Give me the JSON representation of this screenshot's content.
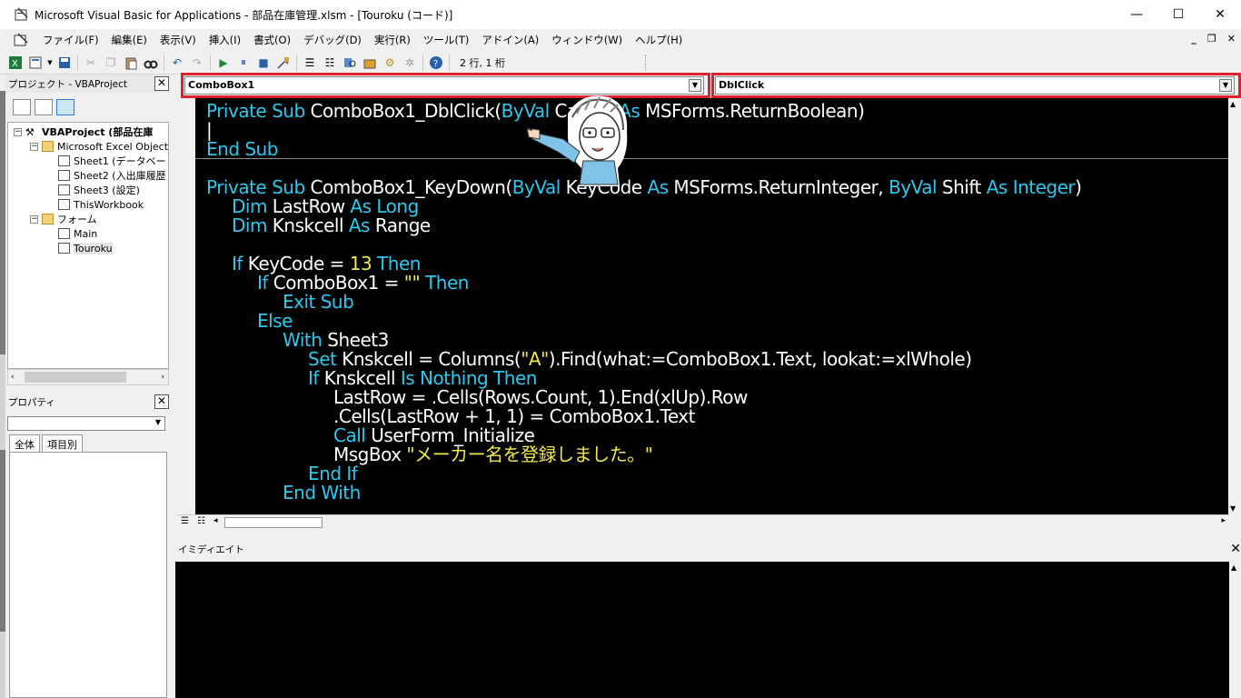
{
  "window": {
    "title": "Microsoft Visual Basic for Applications - 部品在庫管理.xlsm - [Touroku (コード)]",
    "minimize": "—",
    "maximize": "☐",
    "close": "✕"
  },
  "menu": [
    "ファイル(F)",
    "編集(E)",
    "表示(V)",
    "挿入(I)",
    "書式(O)",
    "デバッグ(D)",
    "実行(R)",
    "ツール(T)",
    "アドイン(A)",
    "ウィンドウ(W)",
    "ヘルプ(H)"
  ],
  "mdi": {
    "minimize": "_",
    "restore": "❐",
    "close": "✕"
  },
  "toolbar": {
    "status": "2 行, 1 桁"
  },
  "project": {
    "title": "プロジェクト - VBAProject",
    "tree": [
      {
        "label": "VBAProject (部品在庫",
        "level": 0,
        "type": "vba",
        "toggle": "−",
        "bold": true
      },
      {
        "label": "Microsoft Excel Object",
        "level": 1,
        "type": "folder",
        "toggle": "−"
      },
      {
        "label": "Sheet1 (データベー",
        "level": 2,
        "type": "sheet",
        "toggle": ""
      },
      {
        "label": "Sheet2 (入出庫履歴",
        "level": 2,
        "type": "sheet",
        "toggle": ""
      },
      {
        "label": "Sheet3 (設定)",
        "level": 2,
        "type": "sheet",
        "toggle": ""
      },
      {
        "label": "ThisWorkbook",
        "level": 2,
        "type": "sheet",
        "toggle": ""
      },
      {
        "label": "フォーム",
        "level": 1,
        "type": "folder",
        "toggle": "−"
      },
      {
        "label": "Main",
        "level": 2,
        "type": "form",
        "toggle": ""
      },
      {
        "label": "Touroku",
        "level": 2,
        "type": "form",
        "toggle": "",
        "selected": true
      }
    ]
  },
  "properties": {
    "title": "プロパティ",
    "tabs": [
      "全体",
      "項目別"
    ]
  },
  "code": {
    "object_combo": "ComboBox1",
    "procedure_combo": "DblClick",
    "highlight_color": "#e0202a",
    "lines": [
      {
        "indent": 0,
        "tokens": [
          [
            "kw",
            "Private Sub "
          ],
          [
            "t",
            "ComboBox1_DblClick("
          ],
          [
            "kw",
            "ByVal "
          ],
          [
            "t",
            "Cancel "
          ],
          [
            "kw",
            "As "
          ],
          [
            "t",
            "MSForms.ReturnBoolean)"
          ]
        ]
      },
      {
        "indent": 0,
        "tokens": [
          [
            "t",
            "|"
          ]
        ]
      },
      {
        "indent": 0,
        "tokens": [
          [
            "kw",
            "End Sub"
          ]
        ]
      },
      {
        "indent": 0,
        "tokens": []
      },
      {
        "indent": 0,
        "tokens": [
          [
            "kw",
            "Private Sub "
          ],
          [
            "t",
            "ComboBox1_KeyDown("
          ],
          [
            "kw",
            "ByVal "
          ],
          [
            "t",
            "KeyCode "
          ],
          [
            "kw",
            "As "
          ],
          [
            "t",
            "MSForms.ReturnInteger, "
          ],
          [
            "kw",
            "ByVal "
          ],
          [
            "t",
            "Shift "
          ],
          [
            "kw",
            "As Integer"
          ],
          [
            "t",
            ")"
          ]
        ]
      },
      {
        "indent": 1,
        "tokens": [
          [
            "kw",
            "Dim "
          ],
          [
            "t",
            "LastRow "
          ],
          [
            "kw",
            "As Long"
          ]
        ]
      },
      {
        "indent": 1,
        "tokens": [
          [
            "kw",
            "Dim "
          ],
          [
            "t",
            "Knskcell "
          ],
          [
            "kw",
            "As "
          ],
          [
            "t",
            "Range"
          ]
        ]
      },
      {
        "indent": 0,
        "tokens": []
      },
      {
        "indent": 1,
        "tokens": [
          [
            "kw",
            "If "
          ],
          [
            "t",
            "KeyCode = "
          ],
          [
            "num",
            "13 "
          ],
          [
            "kw",
            "Then"
          ]
        ]
      },
      {
        "indent": 2,
        "tokens": [
          [
            "kw",
            "If "
          ],
          [
            "t",
            "ComboBox1 = "
          ],
          [
            "str",
            "\"\" "
          ],
          [
            "kw",
            "Then"
          ]
        ]
      },
      {
        "indent": 3,
        "tokens": [
          [
            "kw",
            "Exit Sub"
          ]
        ]
      },
      {
        "indent": 2,
        "tokens": [
          [
            "kw",
            "Else"
          ]
        ]
      },
      {
        "indent": 3,
        "tokens": [
          [
            "kw",
            "With "
          ],
          [
            "t",
            "Sheet3"
          ]
        ]
      },
      {
        "indent": 4,
        "tokens": [
          [
            "kw",
            "Set "
          ],
          [
            "t",
            "Knskcell = Columns("
          ],
          [
            "str",
            "\"A\""
          ],
          [
            "t",
            ").Find(what:=ComboBox1.Text, lookat:=xlWhole)"
          ]
        ]
      },
      {
        "indent": 4,
        "tokens": [
          [
            "kw",
            "If "
          ],
          [
            "t",
            "Knskcell "
          ],
          [
            "kw",
            "Is Nothing Then"
          ]
        ]
      },
      {
        "indent": 5,
        "tokens": [
          [
            "t",
            "LastRow = .Cells(Rows.Count, 1).End(xlUp).Row"
          ]
        ]
      },
      {
        "indent": 5,
        "tokens": [
          [
            "t",
            ".Cells(LastRow + 1, 1) = ComboBox1.Text"
          ]
        ]
      },
      {
        "indent": 5,
        "tokens": [
          [
            "kw",
            "Call "
          ],
          [
            "t",
            "UserForm_Initialize"
          ]
        ]
      },
      {
        "indent": 5,
        "tokens": [
          [
            "t",
            "MsgBox "
          ],
          [
            "str",
            "\"メーカー名を登録しました。\""
          ]
        ]
      },
      {
        "indent": 4,
        "tokens": [
          [
            "kw",
            "End If"
          ]
        ]
      },
      {
        "indent": 3,
        "tokens": [
          [
            "kw",
            "End With"
          ]
        ]
      }
    ]
  },
  "immediate": {
    "title": "イミディエイト"
  }
}
